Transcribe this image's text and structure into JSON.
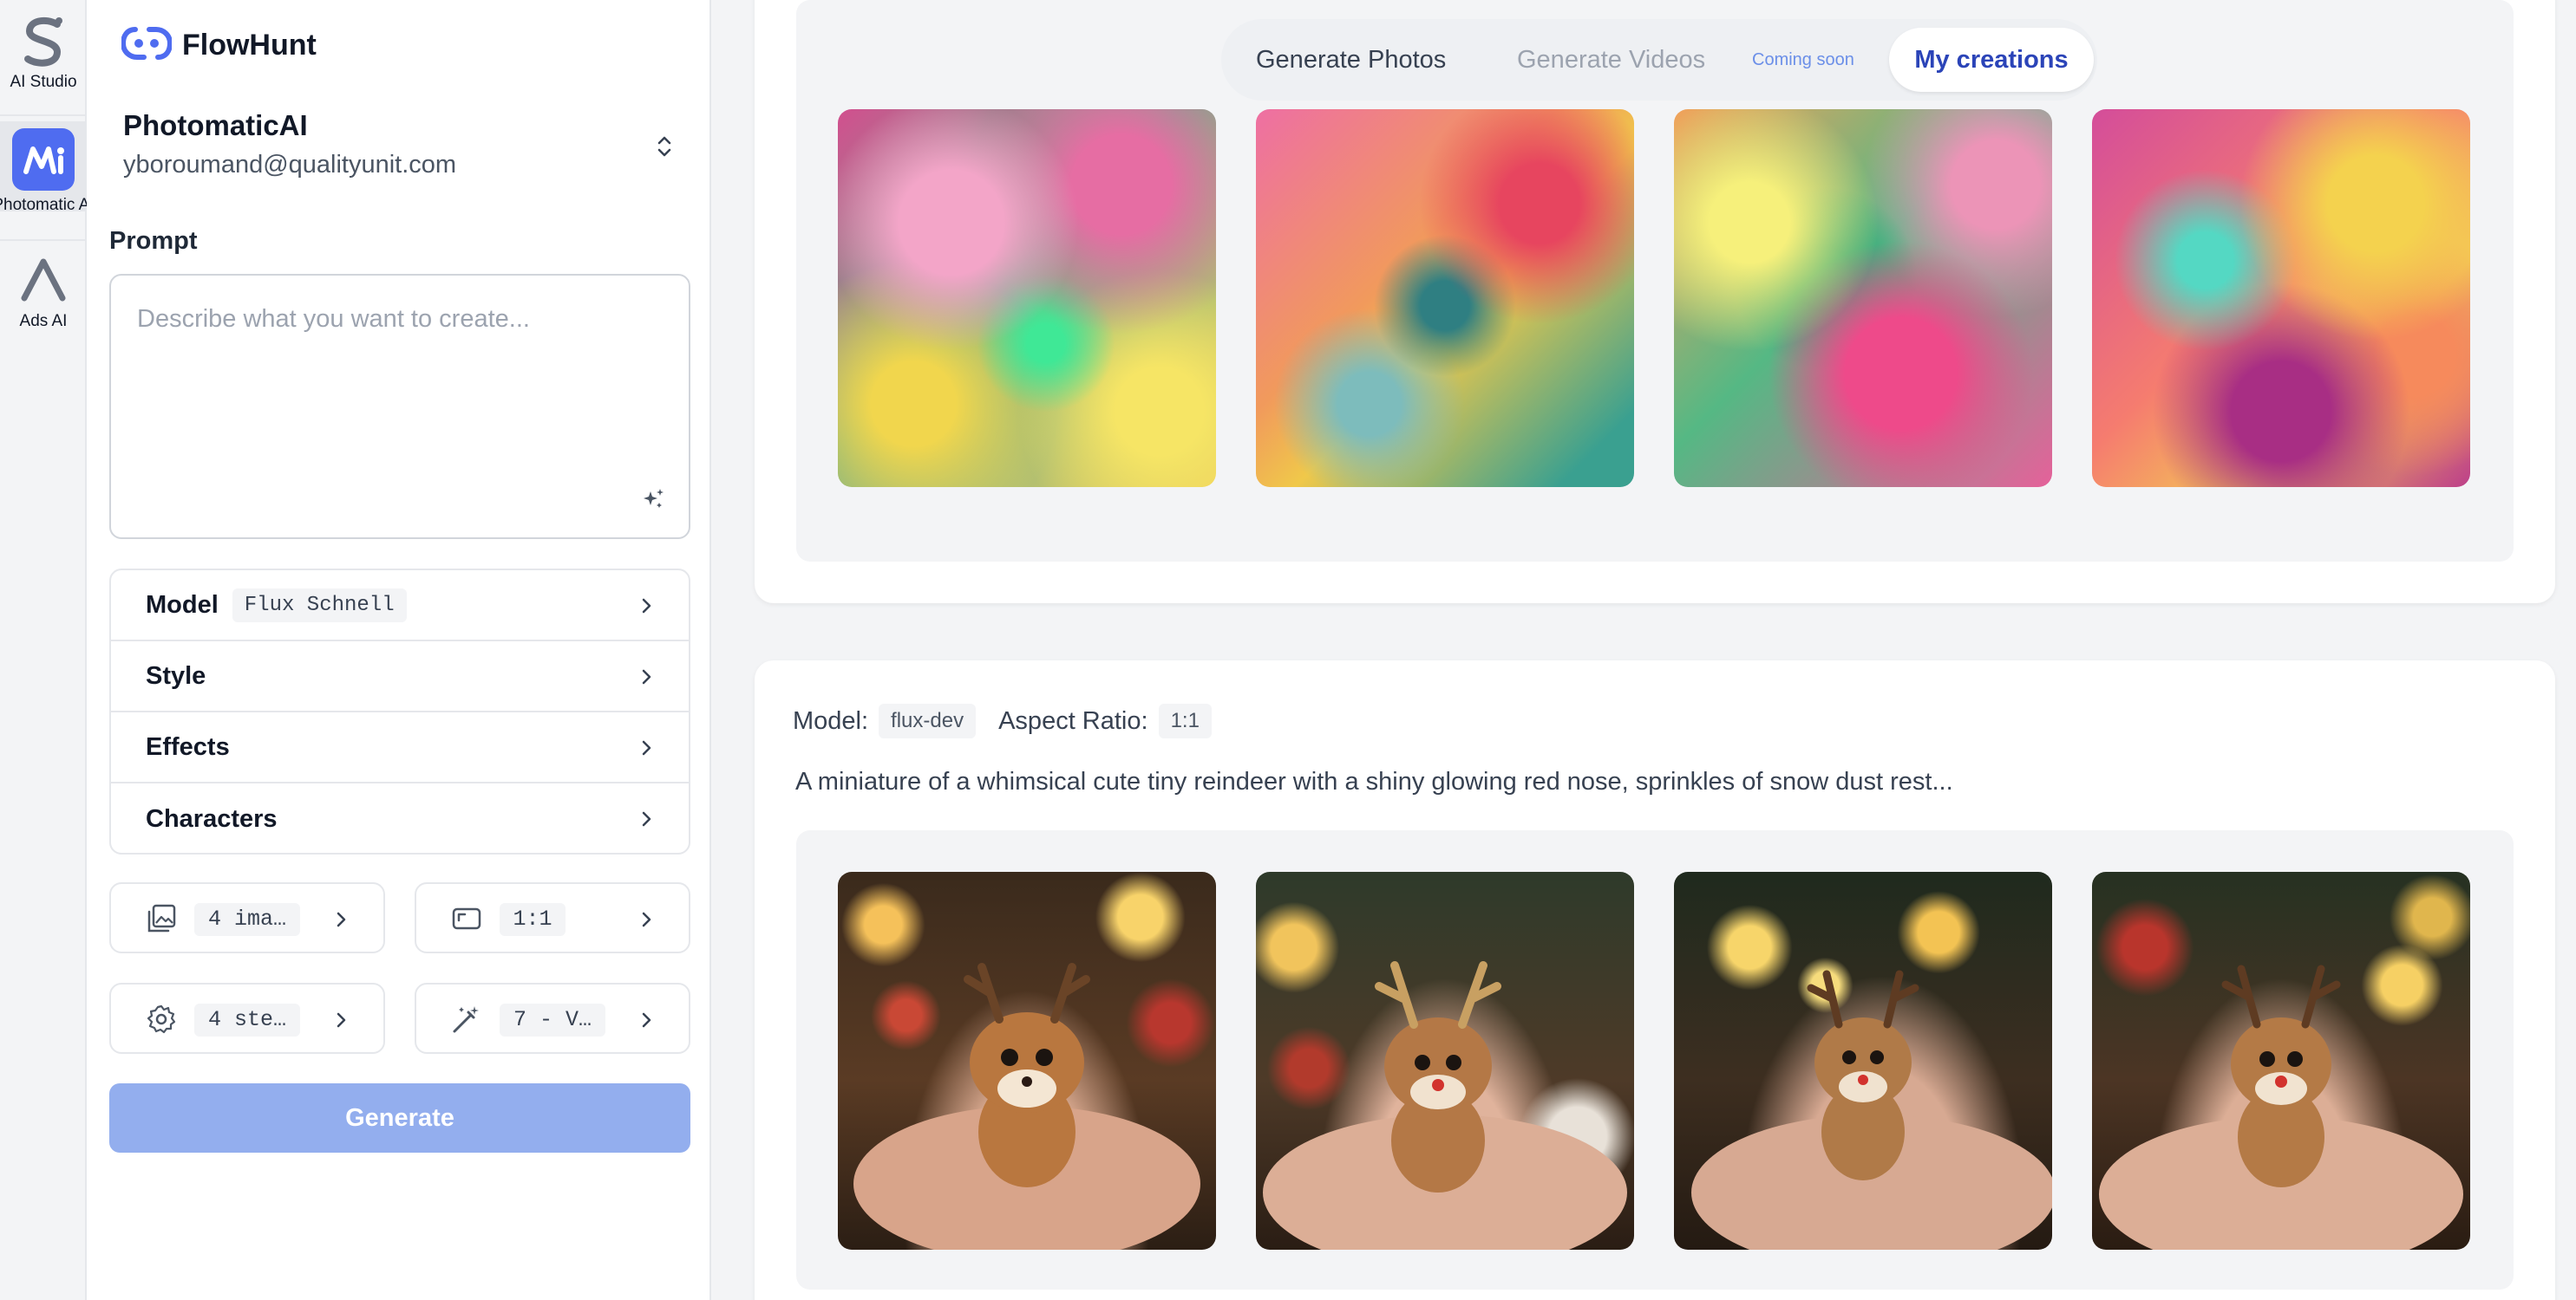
{
  "rail": {
    "items": [
      {
        "label": "AI Studio",
        "icon": "ai-studio-logo-icon"
      },
      {
        "label": "Photomatic AI",
        "icon": "photomatic-logo-icon"
      },
      {
        "label": "Ads AI",
        "icon": "ads-ai-logo-icon"
      }
    ]
  },
  "brand": {
    "name": "FlowHunt",
    "icon": "flowhunt-logo-icon"
  },
  "account": {
    "name": "PhotomaticAI",
    "email": "yboroumand@qualityunit.com"
  },
  "prompt": {
    "label": "Prompt",
    "placeholder": "Describe what you want to create...",
    "value": ""
  },
  "options": [
    {
      "label": "Model",
      "value": "Flux Schnell"
    },
    {
      "label": "Style",
      "value": ""
    },
    {
      "label": "Effects",
      "value": ""
    },
    {
      "label": "Characters",
      "value": ""
    }
  ],
  "quick_settings": {
    "images": "4 ima…",
    "aspect": "1:1",
    "steps": "4 ste…",
    "variant": "7 - V…"
  },
  "generate_label": "Generate",
  "tabs": {
    "photos": "Generate Photos",
    "videos": "Generate Videos",
    "coming_soon": "Coming soon",
    "creations": "My creations"
  },
  "creations": [
    {
      "images": [
        "abstract-swirl-1",
        "abstract-swirl-2",
        "abstract-swirl-3",
        "abstract-swirl-4"
      ]
    },
    {
      "model_label": "Model:",
      "model": "flux-dev",
      "aspect_label": "Aspect Ratio:",
      "aspect": "1:1",
      "prompt": "A miniature of a whimsical cute tiny reindeer with a shiny glowing red nose, sprinkles of snow dust rest...",
      "images": [
        "reindeer-1",
        "reindeer-2",
        "reindeer-3",
        "reindeer-4"
      ]
    }
  ],
  "colors": {
    "accent": "#2b44b8",
    "generate_button": "#93aeee",
    "photomatic_logo": "#4f6cf0"
  }
}
